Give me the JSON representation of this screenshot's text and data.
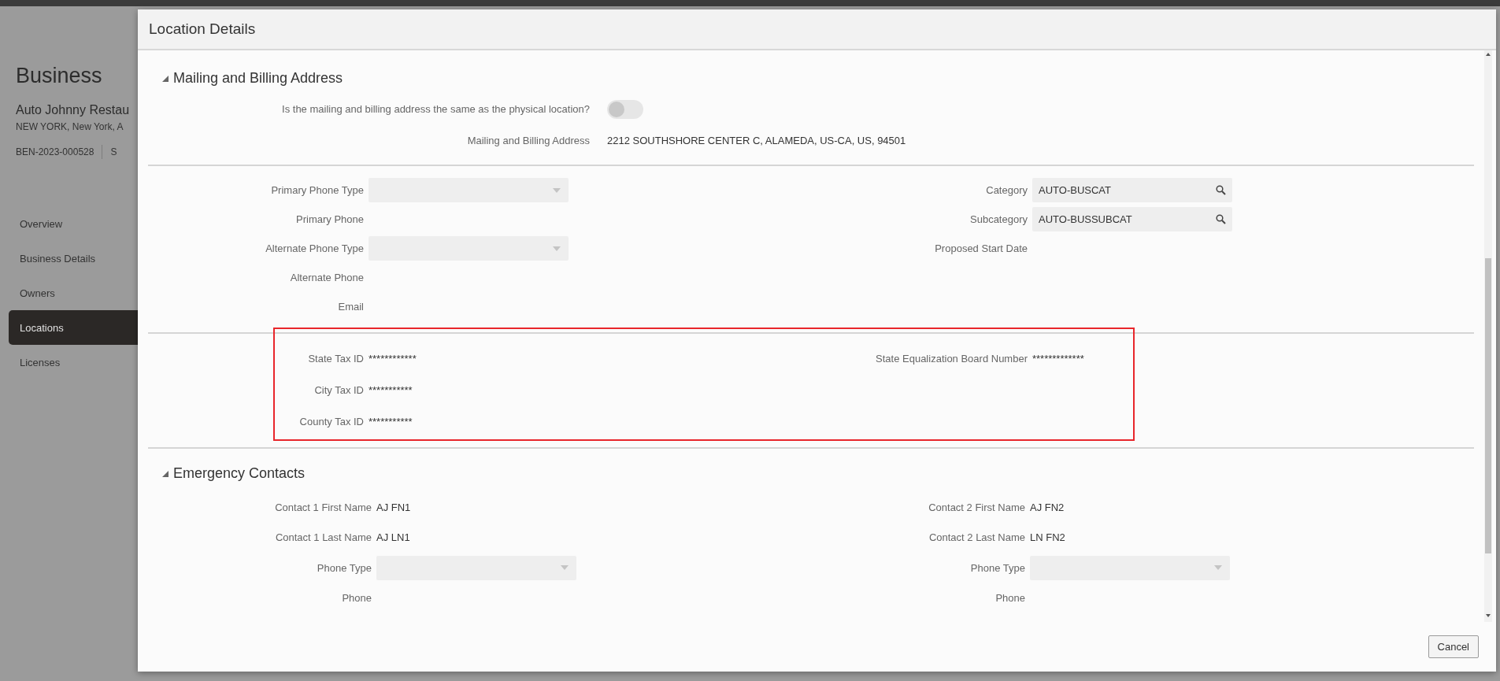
{
  "background_page": {
    "title": "Business",
    "business_name": "Auto Johnny Restau",
    "address": "NEW YORK, New York, A",
    "reference": "BEN-2023-000528",
    "status": "S",
    "nav": [
      {
        "label": "Overview",
        "selected": false
      },
      {
        "label": "Business Details",
        "selected": false
      },
      {
        "label": "Owners",
        "selected": false
      },
      {
        "label": "Locations",
        "selected": true
      },
      {
        "label": "Licenses",
        "selected": false
      }
    ]
  },
  "dialog": {
    "title": "Location Details",
    "sections": [
      {
        "heading": "Mailing and Billing Address",
        "expanded": true,
        "columns": [
          [
            {
              "kind": "toggle",
              "label": "Is the mailing and billing address the same as the physical location?",
              "on": false
            },
            {
              "kind": "text",
              "label": "Mailing and Billing Address",
              "value": "2212 SOUTHSHORE CENTER C, ALAMEDA, US-CA, US, 94501"
            }
          ]
        ]
      },
      {
        "columns": [
          [
            {
              "kind": "select",
              "label": "Primary Phone Type"
            },
            {
              "kind": "text",
              "label": "Primary Phone"
            },
            {
              "kind": "select",
              "label": "Alternate Phone Type"
            },
            {
              "kind": "text",
              "label": "Alternate Phone"
            },
            {
              "kind": "text",
              "label": "Email"
            }
          ],
          [
            {
              "kind": "lookup",
              "label": "Category",
              "value": "AUTO-BUSCAT"
            },
            {
              "kind": "lookup",
              "label": "Subcategory",
              "value": "AUTO-BUSSUBCAT"
            },
            {
              "kind": "text",
              "label": "Proposed Start Date"
            }
          ]
        ]
      },
      {
        "highlighted": true,
        "columns": [
          [
            {
              "kind": "text",
              "label": "State Tax ID",
              "value": "************"
            },
            {
              "kind": "text",
              "label": "City Tax ID",
              "value": "***********"
            },
            {
              "kind": "text",
              "label": "County Tax ID",
              "value": "***********"
            }
          ],
          [
            {
              "kind": "text",
              "label": "State Equalization Board Number",
              "value": "*************"
            }
          ]
        ]
      },
      {
        "heading": "Emergency Contacts",
        "expanded": true,
        "columns": [
          [
            {
              "kind": "text",
              "label": "Contact 1 First Name",
              "value": "AJ FN1"
            },
            {
              "kind": "text",
              "label": "Contact 1 Last Name",
              "value": "AJ LN1"
            },
            {
              "kind": "select",
              "label": "Phone Type"
            },
            {
              "kind": "text",
              "label": "Phone"
            }
          ],
          [
            {
              "kind": "text",
              "label": "Contact 2 First Name",
              "value": "AJ FN2"
            },
            {
              "kind": "text",
              "label": "Contact 2 Last Name",
              "value": "LN FN2"
            },
            {
              "kind": "select",
              "label": "Phone Type"
            },
            {
              "kind": "text",
              "label": "Phone"
            }
          ]
        ]
      }
    ],
    "buttons": [
      {
        "label": "Cancel"
      }
    ]
  }
}
